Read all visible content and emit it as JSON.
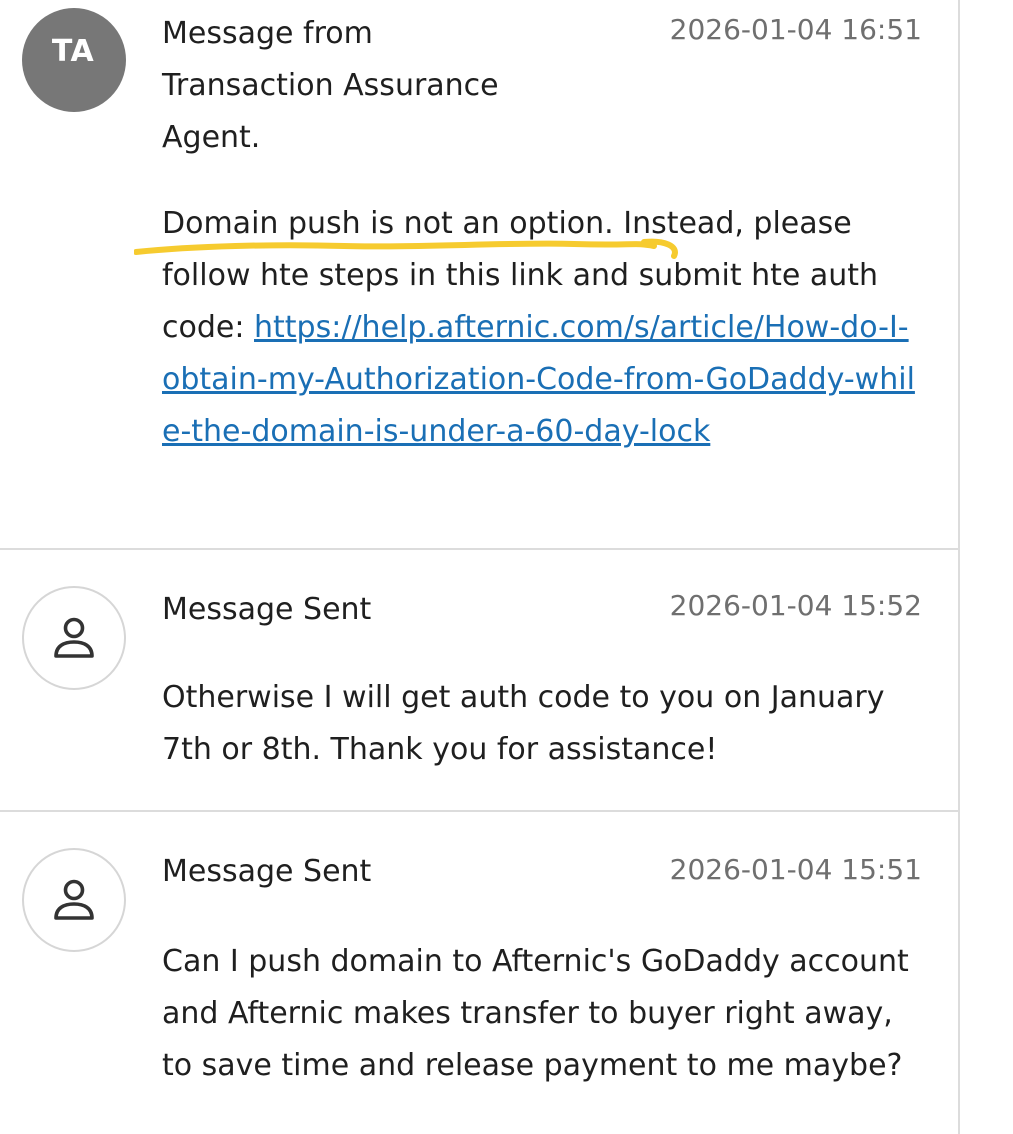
{
  "messages": [
    {
      "avatar_type": "initials",
      "avatar_initials": "TA",
      "sender": "Message from\nTransaction Assurance\nAgent.",
      "timestamp": "2026-01-04 16:51",
      "body_paragraph": "Domain push is not an option. Instead, please follow hte steps in this link and submit hte auth code:",
      "link": "https://help.afternic.com/s/article/How-do-I-obtain-my-Authorization-Code-from-GoDaddy-while-the-domain-is-under-a-60-day-lock"
    },
    {
      "avatar_type": "user",
      "avatar_icon": "user-icon",
      "sender": "Message Sent",
      "timestamp": "2026-01-04 15:52",
      "body_paragraph": "Otherwise I will get auth code to you on January 7th or 8th. Thank you for assistance!"
    },
    {
      "avatar_type": "user",
      "avatar_icon": "user-icon",
      "sender": "Message Sent",
      "timestamp": "2026-01-04 15:51",
      "body_paragraph": "Can I push domain to Afternic's GoDaddy account and Afternic makes transfer to buyer right away, to save time and release payment to me maybe?"
    }
  ],
  "colors": {
    "highlight": "#f5c518",
    "link": "#1a6fb5",
    "avatar_initials_bg": "#777777",
    "divider": "#dcdcdc"
  }
}
